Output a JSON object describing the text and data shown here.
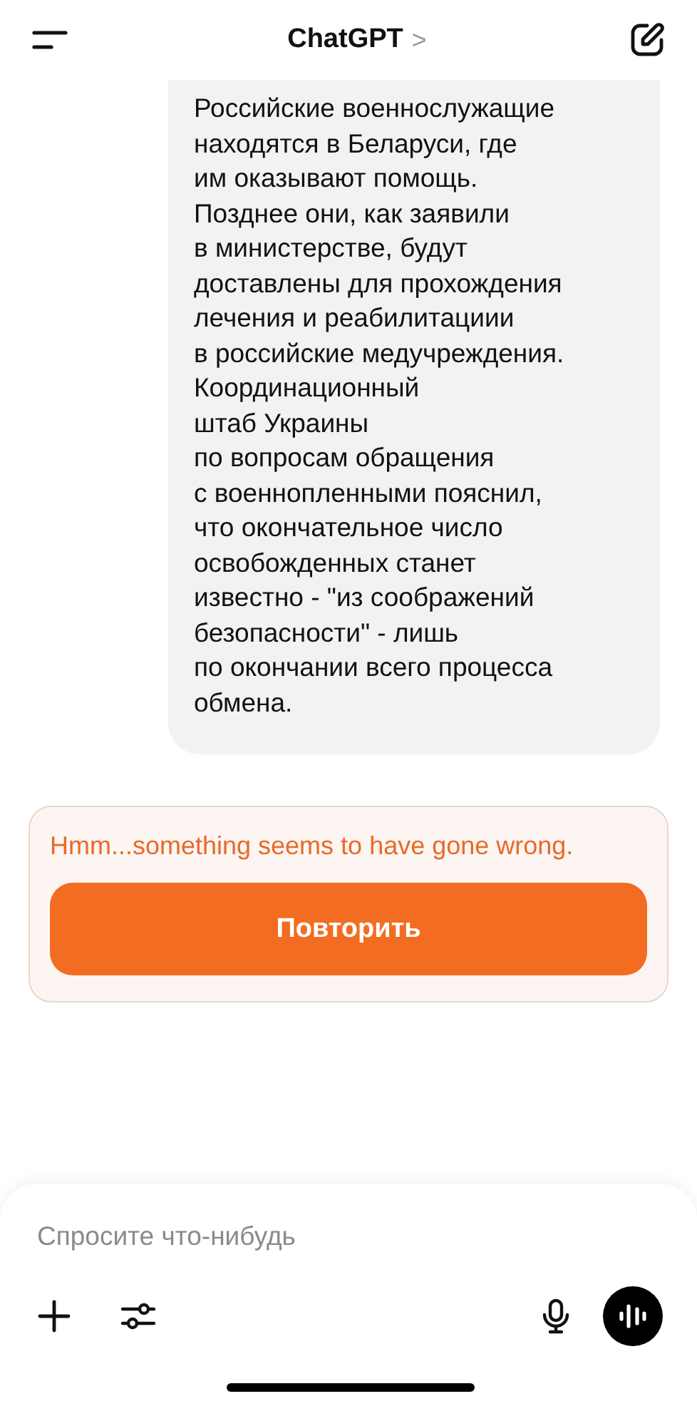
{
  "header": {
    "title": "ChatGPT",
    "chevron": ">"
  },
  "message": {
    "text": "Российские военнослужащие\nнаходятся в Беларуси, где\nим оказывают помощь.\nПозднее они, как заявили\nв министерстве, будут\nдоставлены для прохождения\nлечения и реабилитациии\nв российские медучреждения.\nКоординационный\nштаб Украины\nпо вопросам обращения\nс военнопленными пояснил,\nчто окончательное число\nосвобожденных станет\nизвестно - \"из соображений\nбезопасности\" - лишь\nпо окончании всего процесса\nобмена."
  },
  "error": {
    "text": "Hmm...something seems to have gone wrong.",
    "button": "Повторить"
  },
  "composer": {
    "placeholder": "Спросите что-нибудь"
  }
}
